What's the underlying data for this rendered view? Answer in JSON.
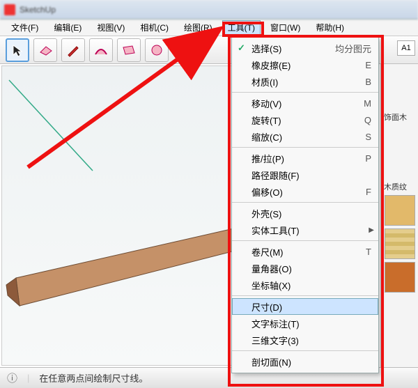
{
  "title": "SketchUp",
  "menubar": {
    "items": [
      {
        "label": "文件(F)"
      },
      {
        "label": "编辑(E)"
      },
      {
        "label": "视图(V)"
      },
      {
        "label": "相机(C)"
      },
      {
        "label": "绘图(R)"
      },
      {
        "label": "工具(T)"
      },
      {
        "label": "窗口(W)"
      },
      {
        "label": "帮助(H)"
      }
    ],
    "active_index": 5
  },
  "toolbar": {
    "tools": [
      {
        "name": "select-tool",
        "glyph": "▲",
        "selected": true
      },
      {
        "name": "eraser-tool",
        "glyph": "◪"
      },
      {
        "name": "pencil-tool",
        "glyph": "／"
      },
      {
        "name": "arc-tool",
        "glyph": "◞"
      },
      {
        "name": "rect-tool",
        "glyph": "▭"
      },
      {
        "name": "circle-tool",
        "glyph": "○"
      }
    ]
  },
  "dropdown": {
    "groups": [
      [
        {
          "label": "选择(S)",
          "shortcut": "均分图元",
          "checked": true
        },
        {
          "label": "橡皮擦(E)",
          "shortcut": "E"
        },
        {
          "label": "材质(I)",
          "shortcut": "B"
        }
      ],
      [
        {
          "label": "移动(V)",
          "shortcut": "M"
        },
        {
          "label": "旋转(T)",
          "shortcut": "Q"
        },
        {
          "label": "缩放(C)",
          "shortcut": "S"
        }
      ],
      [
        {
          "label": "推/拉(P)",
          "shortcut": "P"
        },
        {
          "label": "路径跟随(F)",
          "shortcut": ""
        },
        {
          "label": "偏移(O)",
          "shortcut": "F"
        }
      ],
      [
        {
          "label": "外壳(S)",
          "shortcut": ""
        },
        {
          "label": "实体工具(T)",
          "shortcut": "",
          "submenu": true
        }
      ],
      [
        {
          "label": "卷尺(M)",
          "shortcut": "T"
        },
        {
          "label": "量角器(O)",
          "shortcut": ""
        },
        {
          "label": "坐标轴(X)",
          "shortcut": ""
        }
      ],
      [
        {
          "label": "尺寸(D)",
          "shortcut": "",
          "highlight": true
        },
        {
          "label": "文字标注(T)",
          "shortcut": ""
        },
        {
          "label": "三维文字(3)",
          "shortcut": ""
        }
      ],
      [
        {
          "label": "剖切面(N)",
          "shortcut": ""
        }
      ]
    ]
  },
  "side_panel": {
    "header1": "饰面木",
    "header2": "木质纹",
    "swatches": [
      {
        "name": "wood-light",
        "color": "#e2b96a"
      },
      {
        "name": "wood-stripe",
        "color": "#d9c27a"
      },
      {
        "name": "wood-red",
        "color": "#c96d2b"
      }
    ]
  },
  "status": {
    "message": "在任意两点间绘制尺寸线。"
  },
  "corner_label": "A1"
}
